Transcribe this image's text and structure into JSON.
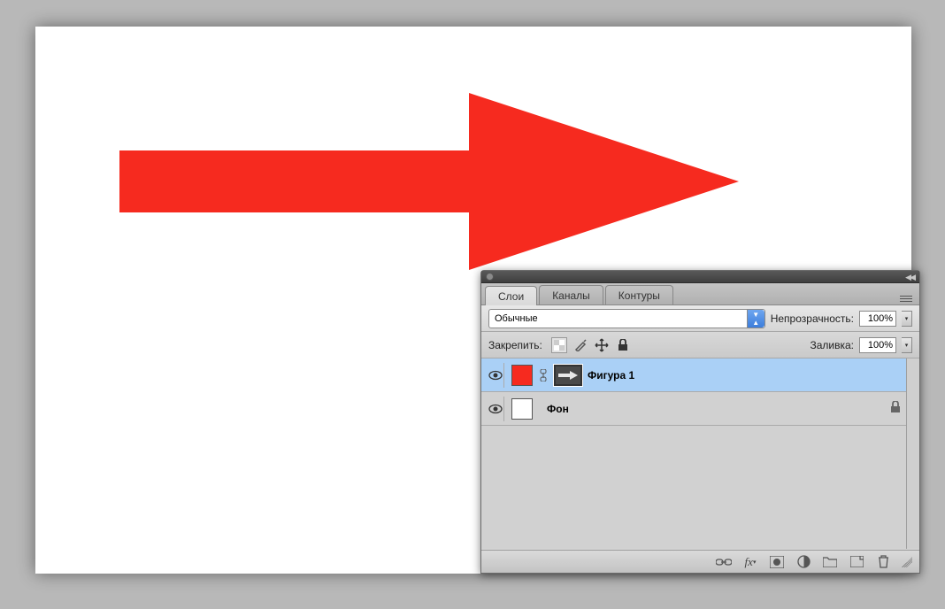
{
  "canvas": {
    "shape": {
      "fill": "#f62a1f"
    }
  },
  "panel": {
    "tabs": [
      {
        "label": "Слои",
        "active": true
      },
      {
        "label": "Каналы",
        "active": false
      },
      {
        "label": "Контуры",
        "active": false
      }
    ],
    "blend_mode": "Обычные",
    "opacity_label": "Непрозрачность:",
    "opacity_value": "100%",
    "lock_label": "Закрепить:",
    "fill_label": "Заливка:",
    "fill_value": "100%",
    "layers": [
      {
        "name": "Фигура 1",
        "selected": true,
        "color": "#f62a1f",
        "mask": true,
        "locked": false
      },
      {
        "name": "Фон",
        "selected": false,
        "color": "#ffffff",
        "mask": false,
        "locked": true
      }
    ],
    "footer_icons": [
      "link-icon",
      "fx-icon",
      "mask-icon",
      "adjust-icon",
      "group-icon",
      "new-icon",
      "trash-icon"
    ]
  }
}
